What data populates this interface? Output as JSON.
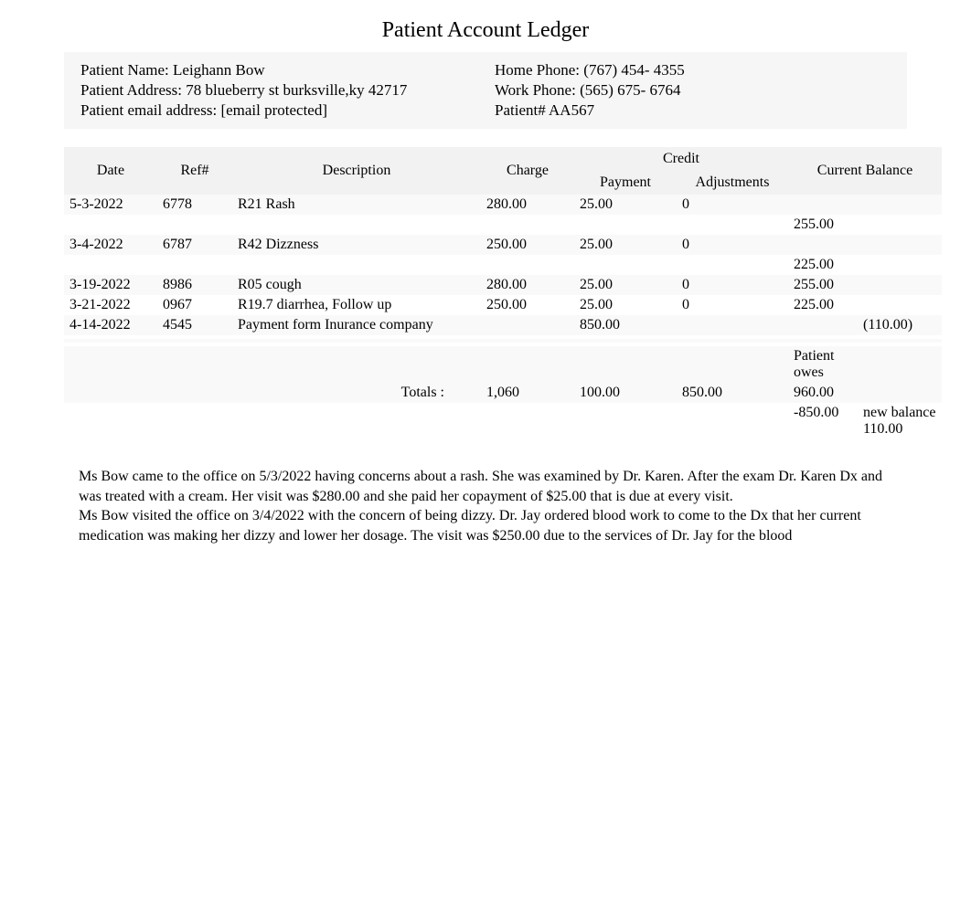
{
  "title": "Patient Account Ledger",
  "patient_info": {
    "name_label": "Patient Name: ",
    "name": "Leighann Bow",
    "address_label": "Patient Address: ",
    "address": "78 blueberry st burksville,ky 42717",
    "email_label": "Patient email address: ",
    "email": "[email protected]",
    "home_phone_label": "Home Phone: ",
    "home_phone": "(767) 454- 4355",
    "work_phone_label": "Work Phone: ",
    "work_phone": "(565) 675- 6764",
    "patient_no_label": "Patient# ",
    "patient_no": "AA567"
  },
  "ledger_headers": {
    "date": "Date",
    "ref": "Ref#",
    "description": "Description",
    "charge": "Charge",
    "credit": "Credit",
    "payment": "Payment",
    "adjustments": "Adjustments",
    "current_balance": "Current Balance"
  },
  "ledger_rows": [
    {
      "date": "5-3-2022",
      "ref": "6778",
      "desc": "R21 Rash",
      "charge": "280.00",
      "payment": "25.00",
      "adjust": "0",
      "balance": "",
      "balance2": ""
    },
    {
      "date": "",
      "ref": "",
      "desc": "",
      "charge": "",
      "payment": "",
      "adjust": "",
      "balance": "255.00",
      "balance2": ""
    },
    {
      "date": "3-4-2022",
      "ref": "6787",
      "desc": "R42 Dizzness",
      "charge": "250.00",
      "payment": "25.00",
      "adjust": "0",
      "balance": "",
      "balance2": ""
    },
    {
      "date": "",
      "ref": "",
      "desc": "",
      "charge": "",
      "payment": "",
      "adjust": "",
      "balance": "225.00",
      "balance2": ""
    },
    {
      "date": "3-19-2022",
      "ref": "8986",
      "desc": "R05 cough",
      "charge": "280.00",
      "payment": "25.00",
      "adjust": "0",
      "balance": "255.00",
      "balance2": ""
    },
    {
      "date": "3-21-2022",
      "ref": "0967",
      "desc": "R19.7 diarrhea, Follow up",
      "charge": "250.00",
      "payment": "25.00",
      "adjust": "0",
      "balance": "225.00",
      "balance2": ""
    },
    {
      "date": "4-14-2022",
      "ref": "4545",
      "desc": "Payment form Inurance company",
      "charge": "",
      "payment": "850.00",
      "adjust": "",
      "balance": "",
      "balance2": "(110.00)"
    },
    {
      "date": "",
      "ref": "",
      "desc": "",
      "charge": "",
      "payment": "",
      "adjust": "",
      "balance": "",
      "balance2": ""
    },
    {
      "date": "",
      "ref": "",
      "desc": "",
      "charge": "",
      "payment": "",
      "adjust": "",
      "balance": "",
      "balance2": ""
    },
    {
      "date": "",
      "ref": "",
      "desc": "",
      "charge": "",
      "payment": "",
      "adjust": "",
      "balance": "",
      "balance2": ""
    },
    {
      "date": "",
      "ref": "",
      "desc": "",
      "charge": "",
      "payment": "",
      "adjust": "",
      "balance": "Patient owes",
      "balance2": ""
    }
  ],
  "totals": {
    "label": "Totals :",
    "charge": "1,060",
    "payment": "100.00",
    "adjust": "850.00",
    "balance": "960.00",
    "minus": "-850.00",
    "note": "new balance 110.00"
  },
  "narrative": {
    "p1": " Ms Bow came to the office on 5/3/2022    having concerns about a rash. She was examined by Dr. Karen. After the exam Dr. Karen Dx and was treated with a cream. Her visit was $280.00 and she paid her copayment of $25.00 that is due at every visit.",
    "p2": "Ms Bow visited the office on 3/4/2022 with the concern of being dizzy. Dr. Jay ordered blood work to come to the Dx that her current medication was making her dizzy and lower her dosage. The visit was $250.00 due to the services of Dr. Jay for the blood"
  }
}
